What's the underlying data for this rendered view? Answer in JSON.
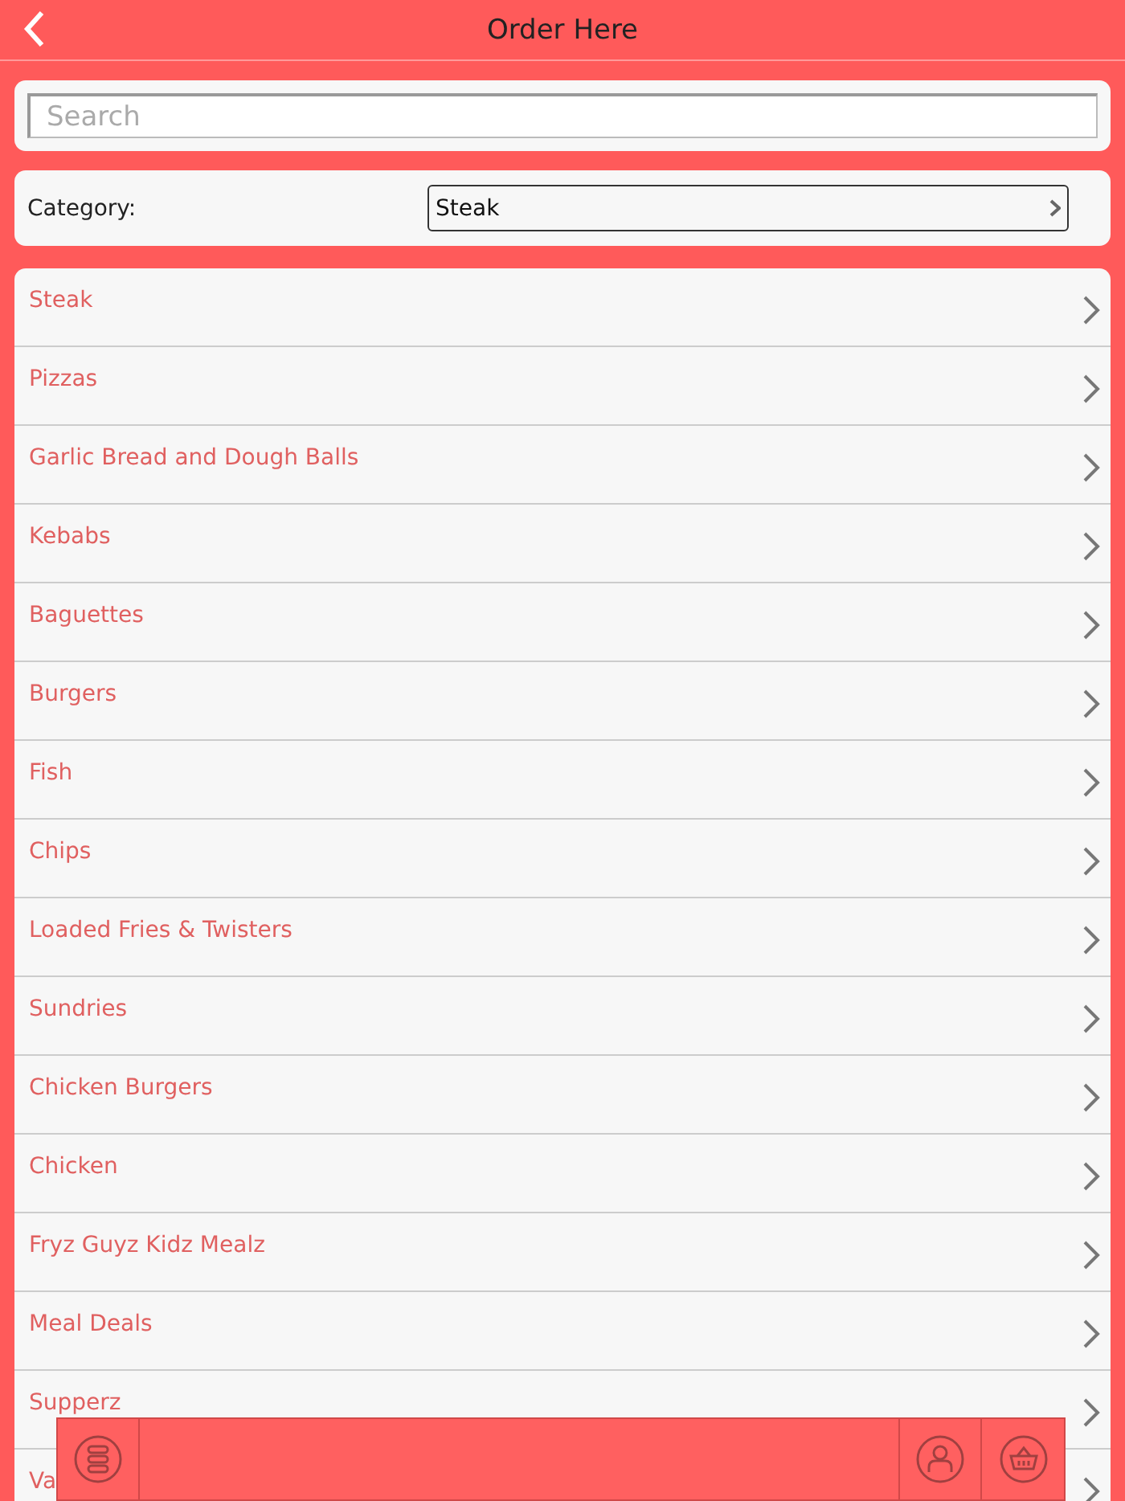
{
  "header": {
    "title": "Order Here"
  },
  "search": {
    "placeholder": "Search"
  },
  "category": {
    "label": "Category:",
    "value": "Steak"
  },
  "items": [
    "Steak",
    "Pizzas",
    "Garlic Bread and Dough Balls",
    "Kebabs",
    "Baguettes",
    "Burgers",
    "Fish",
    "Chips",
    "Loaded Fries & Twisters",
    "Sundries",
    "Chicken Burgers",
    "Chicken",
    "Fryz Guyz Kidz Mealz",
    "Meal Deals",
    "Supperz",
    "Va"
  ]
}
